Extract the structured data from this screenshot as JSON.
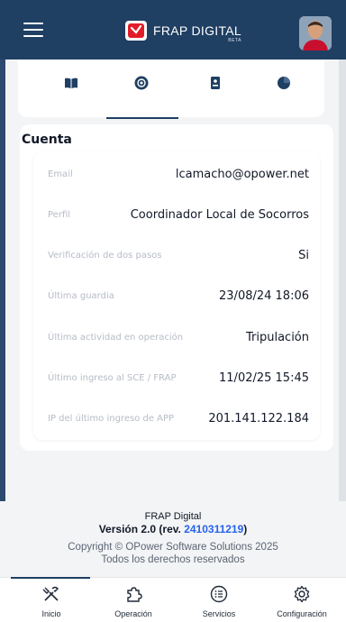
{
  "header": {
    "brand_name": "FRAP DIGITAL",
    "beta_label": "BETA",
    "menu_icon": "hamburger-menu-icon",
    "avatar_icon": "user-avatar"
  },
  "tabs": [
    {
      "icon": "book-icon",
      "active": false
    },
    {
      "icon": "at-sign-icon",
      "active": true
    },
    {
      "icon": "id-badge-icon",
      "active": false
    },
    {
      "icon": "pie-chart-icon",
      "active": false
    }
  ],
  "account": {
    "section_title": "Cuenta",
    "rows": [
      {
        "label": "Email",
        "value": "lcamacho@opower.net"
      },
      {
        "label": "Perfil",
        "value": "Coordinador Local de Socorros"
      },
      {
        "label": "Verificación de dos pasos",
        "value": "Si"
      },
      {
        "label": "Última guardia",
        "value": "23/08/24 18:06"
      },
      {
        "label": "Última actividad en operación",
        "value": "Tripulación"
      },
      {
        "label": "Último ingreso al SCE / FRAP",
        "value": "11/02/25 15:45"
      },
      {
        "label": "IP del último ingreso de APP",
        "value": "201.141.122.184"
      }
    ]
  },
  "footer": {
    "app_name": "FRAP Digital",
    "version_prefix": "Versión 2.0 (rev. ",
    "revision": "2410311219",
    "version_suffix": ")",
    "copyright": "Copyright © OPower Software Solutions 2025",
    "rights": "Todos los derechos reservados"
  },
  "bottom_nav": [
    {
      "label": "Inicio",
      "icon": "tools-icon",
      "active": true
    },
    {
      "label": "Operación",
      "icon": "puzzle-icon",
      "active": false
    },
    {
      "label": "Servicios",
      "icon": "list-icon",
      "active": false
    },
    {
      "label": "Configuración",
      "icon": "gear-icon",
      "active": false
    }
  ],
  "colors": {
    "header_bg": "#1f3f63",
    "accent_blue": "#2563eb",
    "label_gray": "#b6bcc6"
  }
}
